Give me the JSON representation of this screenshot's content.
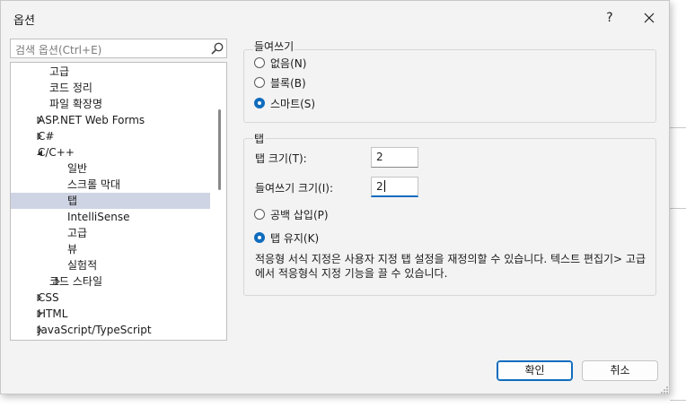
{
  "dialog": {
    "title": "옵션",
    "help_label": "?"
  },
  "search": {
    "placeholder": "검색 옵션(Ctrl+E)"
  },
  "tree": {
    "items": [
      {
        "label": "고급",
        "level": 2,
        "arrow": "none"
      },
      {
        "label": "코드 정리",
        "level": 2,
        "arrow": "none"
      },
      {
        "label": "파일 확장명",
        "level": 2,
        "arrow": "none"
      },
      {
        "label": "ASP.NET Web Forms",
        "level": 1,
        "arrow": "collapsed"
      },
      {
        "label": "C#",
        "level": 1,
        "arrow": "collapsed"
      },
      {
        "label": "C/C++",
        "level": 1,
        "arrow": "expanded"
      },
      {
        "label": "일반",
        "level": 3,
        "arrow": "none"
      },
      {
        "label": "스크롤 막대",
        "level": 3,
        "arrow": "none"
      },
      {
        "label": "탭",
        "level": 3,
        "arrow": "none",
        "selected": true
      },
      {
        "label": "IntelliSense",
        "level": 3,
        "arrow": "none"
      },
      {
        "label": "고급",
        "level": 3,
        "arrow": "none"
      },
      {
        "label": "뷰",
        "level": 3,
        "arrow": "none"
      },
      {
        "label": "실험적",
        "level": 3,
        "arrow": "none"
      },
      {
        "label": "코드 스타일",
        "level": 2,
        "arrow": "collapsed"
      },
      {
        "label": "CSS",
        "level": 1,
        "arrow": "collapsed"
      },
      {
        "label": "HTML",
        "level": 1,
        "arrow": "collapsed"
      },
      {
        "label": "JavaScript/TypeScript",
        "level": 1,
        "arrow": "collapsed"
      }
    ]
  },
  "indenting": {
    "title": "들여쓰기",
    "options": [
      {
        "label": "없음(N)",
        "checked": false
      },
      {
        "label": "블록(B)",
        "checked": false
      },
      {
        "label": "스마트(S)",
        "checked": true
      }
    ]
  },
  "tabs": {
    "title": "탭",
    "tab_size_label": "탭 크기(T):",
    "tab_size_value": "2",
    "indent_size_label": "들여쓰기 크기(I):",
    "indent_size_value": "2",
    "options": [
      {
        "label": "공백 삽입(P)",
        "checked": false
      },
      {
        "label": "탭 유지(K)",
        "checked": true
      }
    ],
    "note": "적응형 서식 지정은 사용자 지정 탭 설정을 재정의할 수 있습니다. 텍스트 편집기> 고급에서 적응형식 지정 기능을 끌 수 있습니다."
  },
  "buttons": {
    "ok": "확인",
    "cancel": "취소"
  },
  "colors": {
    "accent": "#0f6cbd",
    "selection": "#cfd4e4",
    "dialog_bg": "#f3f3f3"
  }
}
